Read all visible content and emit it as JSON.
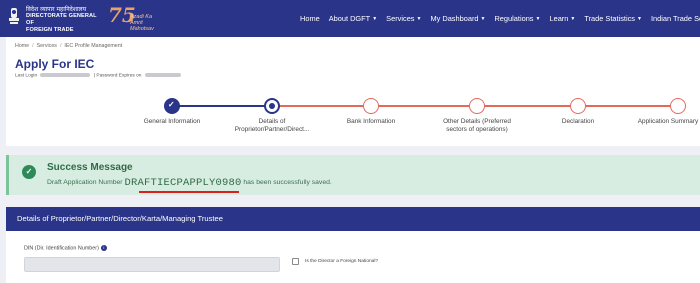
{
  "brand": {
    "hindi": "विदेश व्यापार महानिदेशालय",
    "line1": "DIRECTORATE GENERAL OF",
    "line2": "FOREIGN TRADE",
    "azadi_number": "75",
    "azadi_line1": "Azadi Ka",
    "azadi_line2": "Amrit Mahotsav"
  },
  "nav": {
    "items": [
      {
        "label": "Home",
        "dropdown": false
      },
      {
        "label": "About DGFT",
        "dropdown": true
      },
      {
        "label": "Services",
        "dropdown": true
      },
      {
        "label": "My Dashboard",
        "dropdown": true
      },
      {
        "label": "Regulations",
        "dropdown": true
      },
      {
        "label": "Learn",
        "dropdown": true
      },
      {
        "label": "Trade Statistics",
        "dropdown": true
      },
      {
        "label": "Indian Trade Service",
        "dropdown": true
      }
    ]
  },
  "breadcrumb": [
    "Home",
    "Services",
    "IEC Profile Management"
  ],
  "page": {
    "title": "Apply For IEC",
    "last_login_label": "Last Login",
    "password_expires_label": "| Password Expires on"
  },
  "steps": [
    {
      "label": "General Information",
      "status": "done"
    },
    {
      "label": "Details of Proprietor/Partner/Direct...",
      "status": "active"
    },
    {
      "label": "Bank Information",
      "status": "todo"
    },
    {
      "label": "Other Details (Preferred sectors of operations)",
      "status": "todo"
    },
    {
      "label": "Declaration",
      "status": "todo"
    },
    {
      "label": "Application Summary",
      "status": "todo"
    }
  ],
  "success": {
    "title": "Success Message",
    "text_before": "Draft Application Number",
    "application_number": "DRAFTIECPAPPLY0980",
    "text_after": "has been successfully saved."
  },
  "section": {
    "title": "Details of Proprietor/Partner/Director/Karta/Managing Trustee"
  },
  "form": {
    "din_label": "DIN (Dir. Identification Number)",
    "din_value": "",
    "foreign_national_label": "Is the Director a Foreign National?",
    "foreign_national_checked": false
  },
  "colors": {
    "primary": "#2a3489",
    "todo_step": "#e36a5b",
    "success_bg": "#d8ede1",
    "success_icon": "#2e8b57"
  }
}
